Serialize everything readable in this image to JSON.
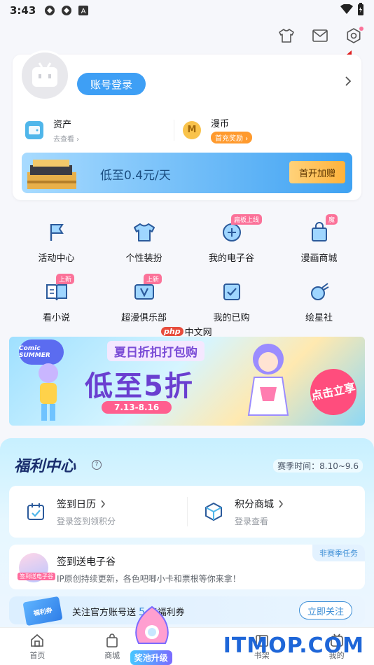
{
  "status_bar": {
    "time": "3:43",
    "icons": [
      "app-icon-1",
      "app-icon-2",
      "a-icon"
    ],
    "right_icons": [
      "wifi-icon",
      "battery-icon"
    ]
  },
  "header": {
    "icons": [
      "shirt-icon",
      "mail-icon",
      "settings-icon"
    ]
  },
  "profile": {
    "login_label": "账号登录",
    "assets": {
      "title": "资产",
      "sub": "去查看 ›"
    },
    "coins": {
      "title": "漫币",
      "tag": "首充奖励 ›",
      "icon_letter": "M"
    },
    "vip": {
      "text": "低至0.4元/天",
      "button": "首开加赠"
    }
  },
  "grid": [
    {
      "label": "活动中心",
      "icon": "flag-icon",
      "badge": ""
    },
    {
      "label": "个性装扮",
      "icon": "tshirt-icon",
      "badge": ""
    },
    {
      "label": "我的电子谷",
      "icon": "badge-icon",
      "badge": "扁板上线"
    },
    {
      "label": "漫画商城",
      "icon": "shop-bag-icon",
      "badge": "魔"
    },
    {
      "label": "看小说",
      "icon": "book-icon",
      "badge": "上新"
    },
    {
      "label": "超漫俱乐部",
      "icon": "v-club-icon",
      "badge": "上新"
    },
    {
      "label": "我的已购",
      "icon": "purchased-icon",
      "badge": ""
    },
    {
      "label": "绘星社",
      "icon": "comet-icon",
      "badge": ""
    }
  ],
  "watermark_php": {
    "logo": "php",
    "text": "中文网"
  },
  "promo": {
    "logo": "Comic SUMMER",
    "title": "夏日折扣打包购",
    "main": "低至5折",
    "date": "7.13-8.16",
    "cta": "点击立享"
  },
  "welfare": {
    "title": "福利中心",
    "help": "?",
    "season": "赛季时间：8.10~9.6",
    "checkin": {
      "title": "签到日历",
      "sub": "登录签到领积分"
    },
    "points": {
      "title": "积分商城",
      "sub": "登录查看"
    },
    "task": {
      "title": "签到送电子谷",
      "sub": "IP原创持续更新，各色吧唧小卡和票根等你来拿！",
      "tag": "非赛季任务",
      "avatar_tag": "签到送电子谷"
    },
    "follow": {
      "ticket": "福利券",
      "text_before": "关注官方账号送",
      "num": "5",
      "text_after": "张福利券",
      "button": "立即关注"
    }
  },
  "nav": [
    {
      "label": "首页",
      "icon": "home-icon"
    },
    {
      "label": "商城",
      "icon": "shop-icon"
    },
    {
      "label": "奖池升级",
      "icon": "pool-icon"
    },
    {
      "label": "书架",
      "icon": "bookshelf-icon"
    },
    {
      "label": "我的",
      "icon": "me-icon"
    }
  ],
  "watermark_itmop": "ITMOP.COM",
  "colors": {
    "accent": "#3e9ff5",
    "pink": "#fb7299",
    "arrow": "#e02020"
  }
}
